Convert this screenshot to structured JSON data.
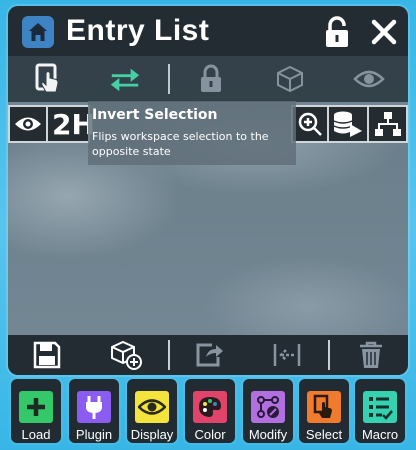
{
  "window": {
    "title": "Entry List",
    "icons": [
      "home-icon",
      "unlock-icon",
      "close-icon"
    ]
  },
  "toolbar": {
    "buttons": [
      {
        "name": "touch-select-icon",
        "state": "active"
      },
      {
        "name": "swap-arrows-icon",
        "state": "highlighted",
        "color": "#3fd7a6"
      },
      {
        "name": "lock-icon",
        "state": "disabled"
      },
      {
        "name": "cube-wireframe-icon",
        "state": "disabled"
      },
      {
        "name": "eye-icon",
        "state": "disabled"
      }
    ]
  },
  "entry_row": {
    "visible_text": "2H",
    "icons": [
      "eye-icon",
      "zoom-in-icon",
      "database-play-icon",
      "hierarchy-icon"
    ]
  },
  "tooltip": {
    "title": "Invert Selection",
    "description": "Flips workspace selection to the opposite state"
  },
  "bottom_toolbar": {
    "icons": [
      "save-icon",
      "add-object-icon",
      "export-icon",
      "collapse-icon",
      "trash-icon"
    ]
  },
  "dock": {
    "buttons": [
      {
        "label": "Load",
        "icon": "plus-icon",
        "color": "#34c86a"
      },
      {
        "label": "Plugin",
        "icon": "plug-icon",
        "color": "#8a5cf0"
      },
      {
        "label": "Display",
        "icon": "eye-icon",
        "color": "#f2e43c"
      },
      {
        "label": "Color",
        "icon": "palette-icon",
        "color": "#e0446a"
      },
      {
        "label": "Modify",
        "icon": "modify-icon",
        "color": "#b26fe0"
      },
      {
        "label": "Select",
        "icon": "select-icon",
        "color": "#f07a2e"
      },
      {
        "label": "Macro",
        "icon": "macro-list-icon",
        "color": "#35d1b0"
      }
    ]
  },
  "colors": {
    "titlebar": "#232c32",
    "home_button": "#3e83c4",
    "background": "#37b6e6"
  }
}
